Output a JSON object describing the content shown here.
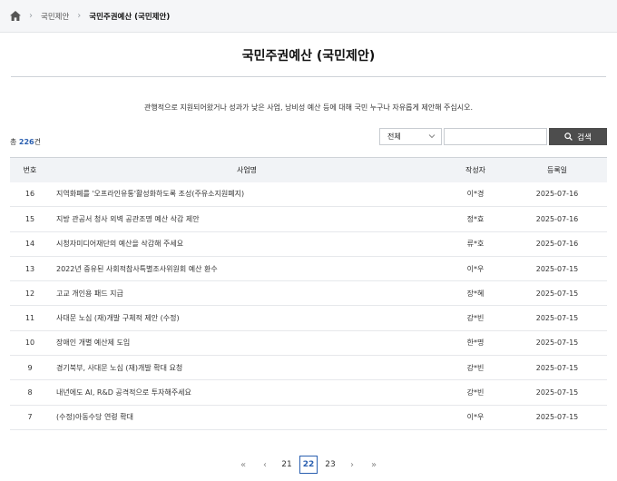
{
  "breadcrumb": {
    "items": [
      "국민제안",
      "국민주권예산 (국민제안)"
    ]
  },
  "page": {
    "title": "국민주권예산 (국민제안)",
    "intro": "관행적으로 지원되어왔거나 성과가 낮은 사업, 낭비성 예산 등에 대해 국민 누구나 자유롭게 제안해 주십시오."
  },
  "total": {
    "prefix": "총 ",
    "count": "226",
    "suffix": "건"
  },
  "search": {
    "filter_value": "전체",
    "input_value": "",
    "button_label": "검색"
  },
  "table": {
    "headers": {
      "num": "번호",
      "title": "사업명",
      "author": "작성자",
      "date": "등록일"
    },
    "rows": [
      {
        "num": "16",
        "title": "지역화폐를 '오프라인유통'활성화하도록 조성(주유소지원폐지)",
        "author": "이*경",
        "date": "2025-07-16"
      },
      {
        "num": "15",
        "title": "지방 관공서 청사 외벽 공관조명 예산 삭감 제안",
        "author": "정*효",
        "date": "2025-07-16"
      },
      {
        "num": "14",
        "title": "시청자미디어재단의 예산을 삭감해 주세요",
        "author": "류*호",
        "date": "2025-07-16"
      },
      {
        "num": "13",
        "title": "2022년 중유된 사회적참사특별조사위원회 예산 환수",
        "author": "이*우",
        "date": "2025-07-15"
      },
      {
        "num": "12",
        "title": "고교 개인용 패드 지급",
        "author": "장*혜",
        "date": "2025-07-15"
      },
      {
        "num": "11",
        "title": "사대문 노심 (재)개발 구체적 제안 (수정)",
        "author": "강*빈",
        "date": "2025-07-15"
      },
      {
        "num": "10",
        "title": "장애인 개별 예산제 도입",
        "author": "한*명",
        "date": "2025-07-15"
      },
      {
        "num": "9",
        "title": "경기북부, 사대문 노심 (재)개발 확대 요청",
        "author": "강*빈",
        "date": "2025-07-15"
      },
      {
        "num": "8",
        "title": "내년에도 AI, R&D 공격적으로 투자해주세요",
        "author": "강*빈",
        "date": "2025-07-15"
      },
      {
        "num": "7",
        "title": "(수정)아동수당 연령 확대",
        "author": "이*우",
        "date": "2025-07-15"
      }
    ]
  },
  "pagination": {
    "first": "«",
    "prev": "‹",
    "next": "›",
    "last": "»",
    "pages": [
      "21",
      "22",
      "23"
    ],
    "current": "22"
  }
}
